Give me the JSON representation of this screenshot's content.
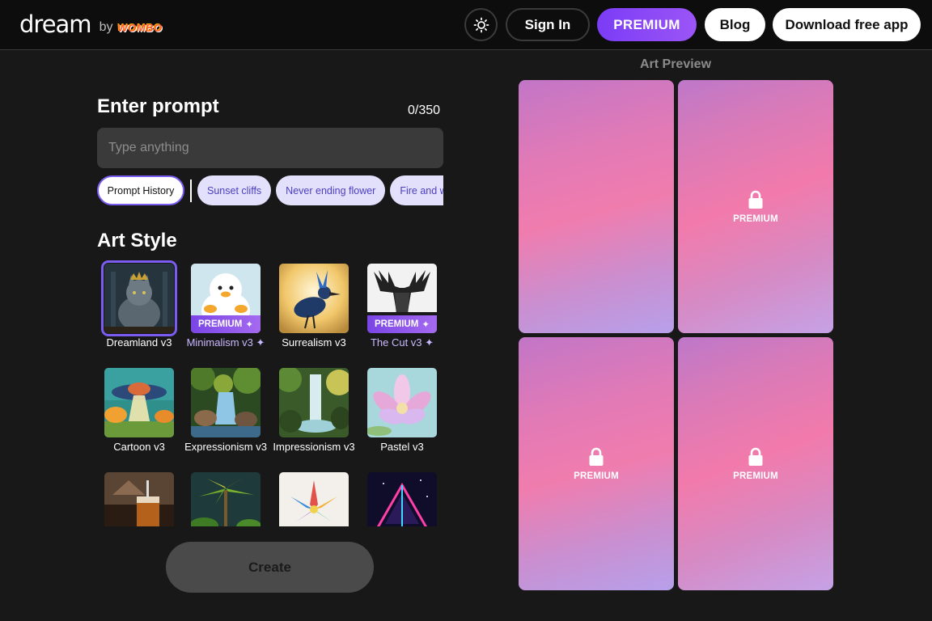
{
  "header": {
    "logo": "dream",
    "by": "by",
    "brand": "WOMBO",
    "signin_label": "Sign In",
    "premium_label": "PREMIUM",
    "blog_label": "Blog",
    "download_label": "Download free app"
  },
  "prompt": {
    "title": "Enter prompt",
    "char_count": "0/350",
    "placeholder": "Type anything",
    "history_label": "Prompt History",
    "suggestions": [
      "Sunset cliffs",
      "Never ending flower",
      "Fire and water"
    ]
  },
  "art_style": {
    "title": "Art Style",
    "premium_tag": "PREMIUM",
    "styles": [
      {
        "label": "Dreamland v3",
        "premium": false,
        "selected": true
      },
      {
        "label": "Minimalism v3",
        "premium": true,
        "selected": false
      },
      {
        "label": "Surrealism v3",
        "premium": false,
        "selected": false
      },
      {
        "label": "The Cut v3",
        "premium": true,
        "selected": false
      },
      {
        "label": "Cartoon v3",
        "premium": false,
        "selected": false
      },
      {
        "label": "Expressionism v3",
        "premium": false,
        "selected": false
      },
      {
        "label": "Impressionism v3",
        "premium": false,
        "selected": false
      },
      {
        "label": "Pastel v3",
        "premium": false,
        "selected": false
      }
    ]
  },
  "create_label": "Create",
  "preview": {
    "title": "Art Preview",
    "lock_label": "PREMIUM"
  },
  "colors": {
    "accent": "#7b5cf0",
    "premium_gradient_start": "#7b3cf5",
    "background": "#181818"
  }
}
